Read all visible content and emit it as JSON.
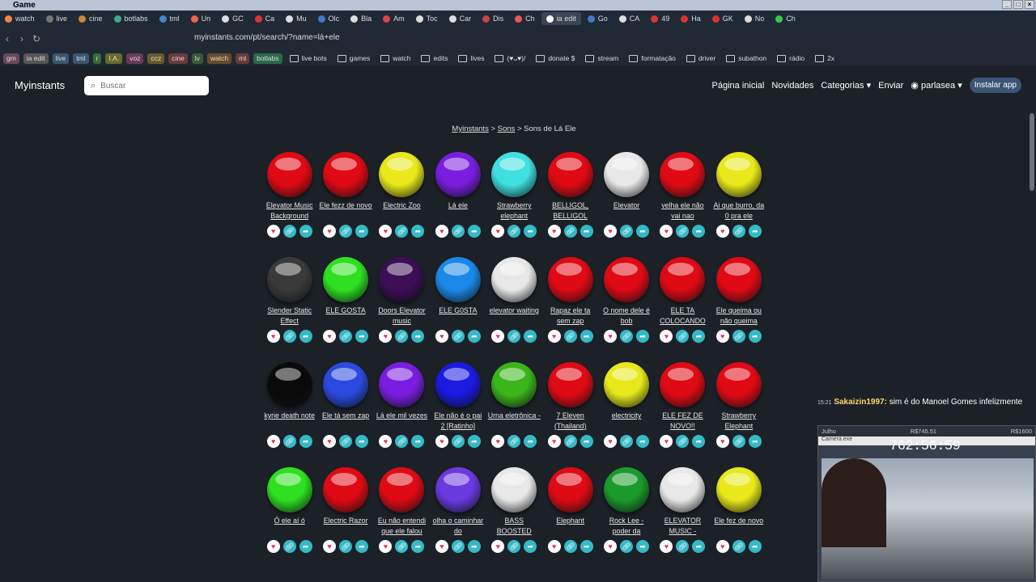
{
  "window": {
    "title": "Game"
  },
  "tabs": [
    {
      "label": "watch",
      "color": "#e84"
    },
    {
      "label": "live",
      "color": "#777"
    },
    {
      "label": "cine",
      "color": "#c83"
    },
    {
      "label": "botlabs",
      "color": "#4a8"
    },
    {
      "label": "tml",
      "color": "#48c"
    },
    {
      "label": "Un",
      "color": "#e64"
    },
    {
      "label": "GC",
      "color": "#ddd"
    },
    {
      "label": "Ca",
      "color": "#d33"
    },
    {
      "label": "Mu",
      "color": "#ddd"
    },
    {
      "label": "Olc",
      "color": "#47c"
    },
    {
      "label": "Bla",
      "color": "#ddd"
    },
    {
      "label": "Am",
      "color": "#d44"
    },
    {
      "label": "Toc",
      "color": "#ddd"
    },
    {
      "label": "Car",
      "color": "#ddd"
    },
    {
      "label": "Dis",
      "color": "#c44"
    },
    {
      "label": "Ch",
      "color": "#e55"
    },
    {
      "label": "ia edit",
      "color": "#fff"
    },
    {
      "label": "Go",
      "color": "#47c"
    },
    {
      "label": "CA",
      "color": "#ddd"
    },
    {
      "label": "49",
      "color": "#d33"
    },
    {
      "label": "Ha",
      "color": "#d33"
    },
    {
      "label": "GK",
      "color": "#d33"
    },
    {
      "label": "No",
      "color": "#ddd"
    },
    {
      "label": "Ch",
      "color": "#3c4"
    }
  ],
  "browser": {
    "url": "myinstants.com/pt/search/?name=lá+ele"
  },
  "bookmarks": [
    "gm",
    "ia edit",
    "live",
    "tml",
    "r",
    "I.A.",
    "voz",
    "ccz",
    "cine",
    "lv",
    "watch",
    "ml",
    "botlabs",
    "live bots",
    "games",
    "watch",
    "edits",
    "lives",
    "(♥ᴗ♥)/",
    "donate $",
    "stream",
    "formatação",
    "driver",
    "subathon",
    "rádio",
    "2x"
  ],
  "site": {
    "logo": "Myinstants",
    "search_placeholder": "Buscar",
    "menu": [
      "Página inicial",
      "Novidades",
      "Categorias ▾",
      "Enviar"
    ],
    "user": "parlasea ▾",
    "install": "Instalar app"
  },
  "breadcrumb": {
    "home": "Myinstants",
    "section": "Sons",
    "current": "> Sons de Lá Ele"
  },
  "sounds": [
    {
      "label": "Elevator Music Background",
      "color": "#e00a14"
    },
    {
      "label": "Ele fezz de novo",
      "color": "#e00a14"
    },
    {
      "label": "Electric Zoo",
      "color": "#e8e81a"
    },
    {
      "label": "Lá ele",
      "color": "#7a1de0"
    },
    {
      "label": "Strawberry elephant",
      "color": "#3fe0e0"
    },
    {
      "label": "BELLIGOL, BELLIGOL",
      "color": "#e00a14"
    },
    {
      "label": "Elevator",
      "color": "#e8e8e8"
    },
    {
      "label": "velha ele não vai nao",
      "color": "#e00a14"
    },
    {
      "label": "Ai que burro, da 0 pra ele",
      "color": "#e8e81a"
    },
    {
      "label": "Slender Static Effect",
      "color": "#3a3a3a"
    },
    {
      "label": "ELE GOSTA",
      "color": "#2ee020"
    },
    {
      "label": "Doors Elevator music",
      "color": "#3b0e55"
    },
    {
      "label": "ELE G0STA",
      "color": "#1a88e8"
    },
    {
      "label": "elevator waiting",
      "color": "#e8e8e8"
    },
    {
      "label": "Rapaz ele ta sem zap",
      "color": "#e00a14"
    },
    {
      "label": "O nome dele é bob",
      "color": "#e00a14"
    },
    {
      "label": "ELE TA COLOCANDO",
      "color": "#e00a14"
    },
    {
      "label": "Ele queima ou não queima",
      "color": "#e00a14"
    },
    {
      "label": "kyrie death note",
      "color": "#0a0a0a"
    },
    {
      "label": "Ele tá sem zap",
      "color": "#2a4ae0"
    },
    {
      "label": "Lá ele mil vezes",
      "color": "#7a1de0"
    },
    {
      "label": "Ele não é o pai 2 [Ratinho]",
      "color": "#1a1ae0"
    },
    {
      "label": "Urna eletrônica -",
      "color": "#3ab51a"
    },
    {
      "label": "7 Eleven (Thailand)",
      "color": "#e00a14"
    },
    {
      "label": "electricity",
      "color": "#e8e81a"
    },
    {
      "label": "ELE FEZ DE NOVO!!",
      "color": "#e00a14"
    },
    {
      "label": "Strawberry Elephant",
      "color": "#e00a14"
    },
    {
      "label": "Ó ele aí ó",
      "color": "#2ee020"
    },
    {
      "label": "Electric Razor",
      "color": "#e00a14"
    },
    {
      "label": "Eu não entendi que ele falou",
      "color": "#e00a14"
    },
    {
      "label": "olha o caminhar do",
      "color": "#6a3ae0"
    },
    {
      "label": "BASS BOOSTED",
      "color": "#e8e8e8"
    },
    {
      "label": "Elephant",
      "color": "#e00a14"
    },
    {
      "label": "Rock Lee - poder da",
      "color": "#1a9a2a"
    },
    {
      "label": "ELEVATOR MUSIC -",
      "color": "#e8e8e8"
    },
    {
      "label": "Ele fez de novo",
      "color": "#e8e81a"
    }
  ],
  "overlay": {
    "chat_time": "15:21",
    "chat_user": "Sakaizin1997:",
    "chat_msg": "sim é do Manoel Gomes infelizmente",
    "month": "Julho",
    "money1": "R$745.51",
    "money2": "R$1600",
    "cam_title": "Camera.exe",
    "timer": "762:56:59"
  }
}
